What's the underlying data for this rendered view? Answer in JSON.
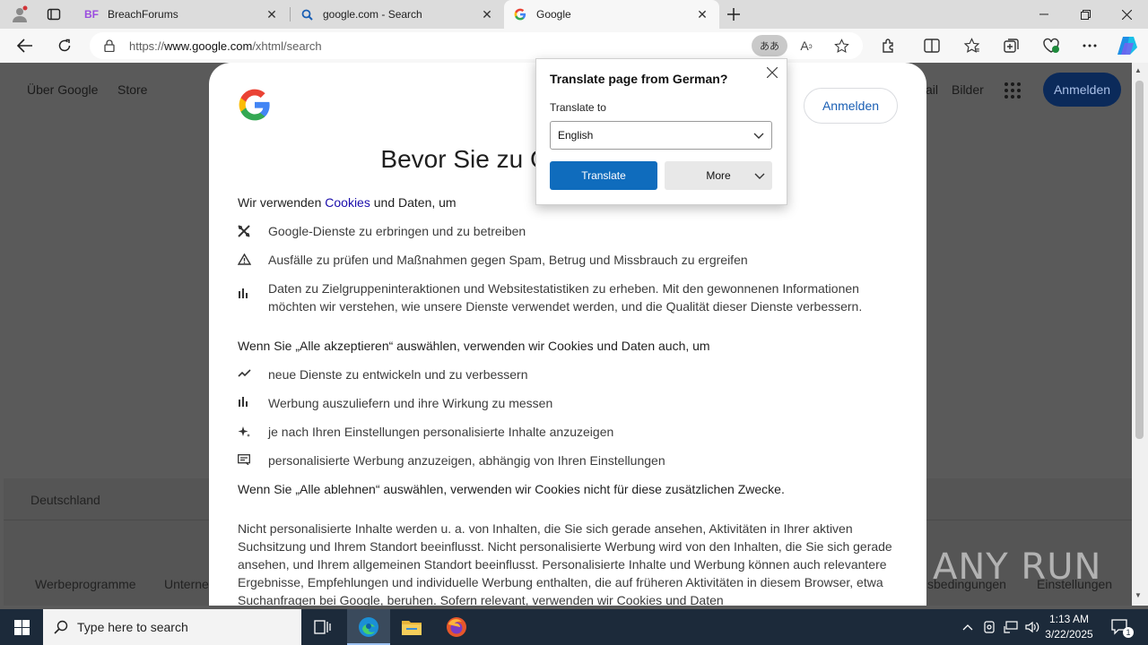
{
  "browser": {
    "tabs": [
      {
        "title": "BreachForums",
        "favicon": "BF",
        "active": false
      },
      {
        "title": "google.com - Search",
        "favicon": "search-icon",
        "active": false
      },
      {
        "title": "Google",
        "favicon": "google-g",
        "active": true
      }
    ],
    "url_prefix": "https://",
    "url_host": "www.google.com",
    "url_path": "/xhtml/search",
    "translate_pill": "ああ"
  },
  "background_page": {
    "top_left_links": [
      "Über Google",
      "Store"
    ],
    "top_right_links": [
      "ail",
      "Bilder"
    ],
    "signin": "Anmelden",
    "country": "Deutschland",
    "footer_left": [
      "Werbeprogramme",
      "Unterne"
    ],
    "footer_right": [
      "sbedingungen",
      "Einstellungen"
    ]
  },
  "consent": {
    "signin": "Anmelden",
    "title": "Bevor Sie zu Google weitergehen",
    "intro_before": "Wir verwenden ",
    "intro_link": "Cookies",
    "intro_after": " und Daten, um",
    "list1": [
      {
        "icon": "tools-icon",
        "text": "Google-Dienste zu erbringen und zu betreiben"
      },
      {
        "icon": "warning-icon",
        "text": "Ausfälle zu prüfen und Maßnahmen gegen Spam, Betrug und Missbrauch zu ergreifen"
      },
      {
        "icon": "bar-chart-icon",
        "text": "Daten zu Zielgruppeninteraktionen und Websitestatistiken zu erheben. Mit den gewonnenen Informationen möchten wir verstehen, wie unsere Dienste verwendet werden, und die Qualität dieser Dienste verbessern."
      }
    ],
    "accept_heading": "Wenn Sie „Alle akzeptieren“ auswählen, verwenden wir Cookies und Daten auch, um",
    "list2": [
      {
        "icon": "trending-icon",
        "text": "neue Dienste zu entwickeln und zu verbessern"
      },
      {
        "icon": "bar-chart-icon",
        "text": "Werbung auszuliefern und ihre Wirkung zu messen"
      },
      {
        "icon": "sparkle-icon",
        "text": "je nach Ihren Einstellungen personalisierte Inhalte anzuzeigen"
      },
      {
        "icon": "ad-icon",
        "text": "personalisierte Werbung anzuzeigen, abhängig von Ihren Einstellungen"
      }
    ],
    "reject_heading": "Wenn Sie „Alle ablehnen“ auswählen, verwenden wir Cookies nicht für diese zusätzlichen Zwecke.",
    "paragraph": "Nicht personalisierte Inhalte werden u. a. von Inhalten, die Sie sich gerade ansehen, Aktivitäten in Ihrer aktiven Suchsitzung und Ihrem Standort beeinflusst. Nicht personalisierte Werbung wird von den Inhalten, die Sie sich gerade ansehen, und Ihrem allgemeinen Standort beeinflusst. Personalisierte Inhalte und Werbung können auch relevantere Ergebnisse, Empfehlungen und individuelle Werbung enthalten, die auf früheren Aktivitäten in diesem Browser, etwa Suchanfragen bei Google, beruhen. Sofern relevant, verwenden wir Cookies und Daten"
  },
  "translate_popup": {
    "title": "Translate page from German?",
    "label": "Translate to",
    "selected_language": "English",
    "translate_button": "Translate",
    "more_button": "More"
  },
  "watermark": "ANY RUN",
  "taskbar": {
    "search_placeholder": "Type here to search",
    "time": "1:13 AM",
    "date": "3/22/2025",
    "notification_count": "1"
  },
  "colors": {
    "edge_blue": "#0f6cbd",
    "google_blue": "#4285F4",
    "google_red": "#EA4335",
    "google_yellow": "#FBBC05",
    "google_green": "#34A853"
  }
}
